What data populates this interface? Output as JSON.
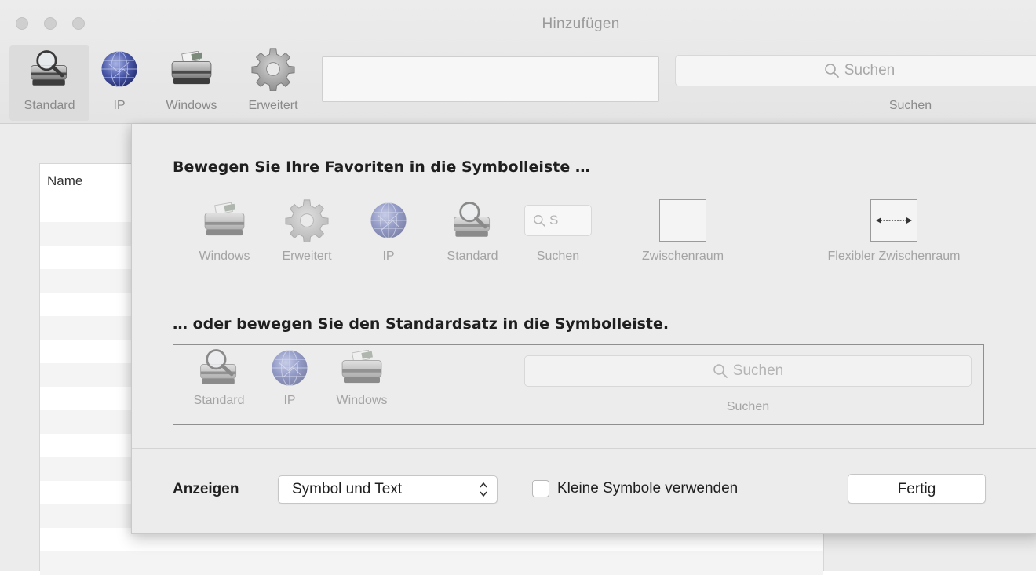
{
  "window": {
    "title": "Hinzufügen"
  },
  "toolbar": {
    "items": [
      {
        "label": "Standard",
        "icon": "printer-magnifier-icon"
      },
      {
        "label": "IP",
        "icon": "globe-icon"
      },
      {
        "label": "Windows",
        "icon": "printer-icon"
      },
      {
        "label": "Erweitert",
        "icon": "gear-icon"
      }
    ],
    "search_placeholder": "Suchen",
    "search_label": "Suchen"
  },
  "list": {
    "column_header": "Name"
  },
  "sheet": {
    "heading_favorites": "Bewegen Sie Ihre Favoriten in die Symbolleiste …",
    "palette": [
      {
        "label": "Windows",
        "icon": "printer-icon"
      },
      {
        "label": "Erweitert",
        "icon": "gear-icon"
      },
      {
        "label": "IP",
        "icon": "globe-icon"
      },
      {
        "label": "Standard",
        "icon": "printer-magnifier-icon"
      },
      {
        "label": "Suchen",
        "icon": "search-field-icon",
        "mini_text": "S"
      },
      {
        "label": "Zwischenraum",
        "icon": "space-icon"
      },
      {
        "label": "Flexibler Zwischenraum",
        "icon": "flexible-space-icon"
      }
    ],
    "heading_default": "… oder bewegen Sie den Standardsatz in die Symbolleiste.",
    "default_set": [
      {
        "label": "Standard",
        "icon": "printer-magnifier-icon"
      },
      {
        "label": "IP",
        "icon": "globe-icon"
      },
      {
        "label": "Windows",
        "icon": "printer-icon"
      }
    ],
    "default_search_placeholder": "Suchen",
    "default_search_label": "Suchen",
    "show_label": "Anzeigen",
    "show_value": "Symbol und Text",
    "small_icons_label": "Kleine Symbole verwenden",
    "done_label": "Fertig"
  }
}
